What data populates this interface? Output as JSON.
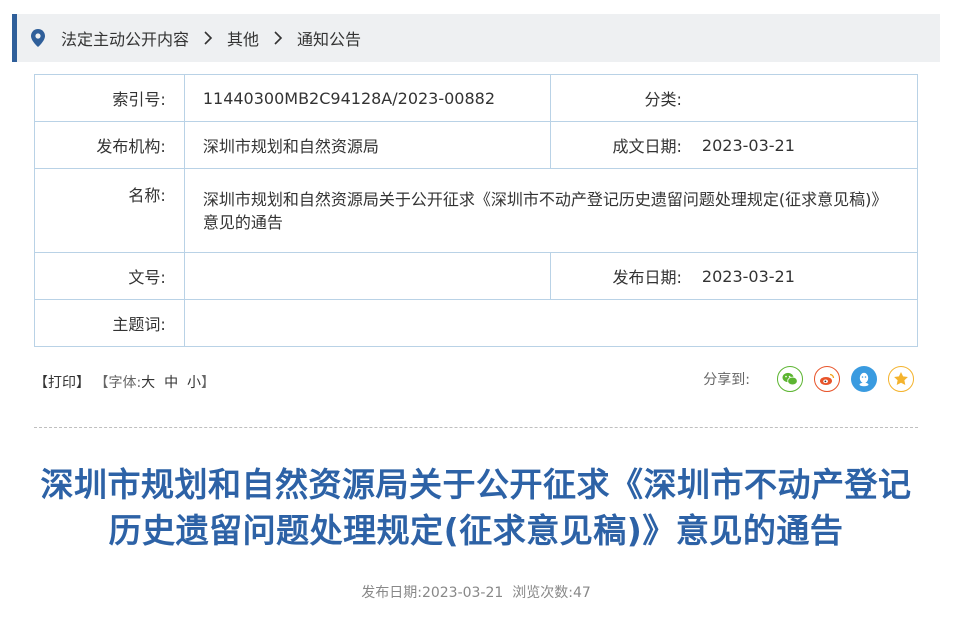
{
  "breadcrumb": {
    "items": [
      "法定主动公开内容",
      "其他",
      "通知公告"
    ]
  },
  "info": {
    "index_label": "索引号:",
    "index_value": "11440300MB2C94128A/2023-00882",
    "category_label": "分类:",
    "category_value": "",
    "issuer_label": "发布机构:",
    "issuer_value": "深圳市规划和自然资源局",
    "created_label": "成文日期:",
    "created_value": "2023-03-21",
    "name_label": "名称:",
    "name_value": "深圳市规划和自然资源局关于公开征求《深圳市不动产登记历史遗留问题处理规定(征求意见稿)》意见的通告",
    "doc_no_label": "文号:",
    "doc_no_value": "",
    "publish_label": "发布日期:",
    "publish_value": "2023-03-21",
    "keywords_label": "主题词:",
    "keywords_value": ""
  },
  "tools": {
    "print": "【打印】",
    "font_prefix": "【字体:",
    "font_large": "大",
    "font_medium": "中",
    "font_small": "小",
    "font_suffix": "】"
  },
  "share": {
    "label": "分享到:",
    "icons": [
      "wechat-icon",
      "weibo-icon",
      "qq-icon",
      "qzone-icon"
    ],
    "colors": {
      "wechat": "#5cb531",
      "weibo": "#e8542a",
      "qq": "#3a9be0",
      "qzone": "#f4b32d"
    }
  },
  "article": {
    "title": "深圳市规划和自然资源局关于公开征求《深圳市不动产登记历史遗留问题处理规定(征求意见稿)》意见的通告",
    "date_label": "发布日期:",
    "date_value": "2023-03-21",
    "views_label": "浏览次数:",
    "views_value": "47"
  },
  "colors": {
    "accent": "#2f5f9a",
    "title": "#2d62a6",
    "table_border": "#b9d2e6"
  }
}
